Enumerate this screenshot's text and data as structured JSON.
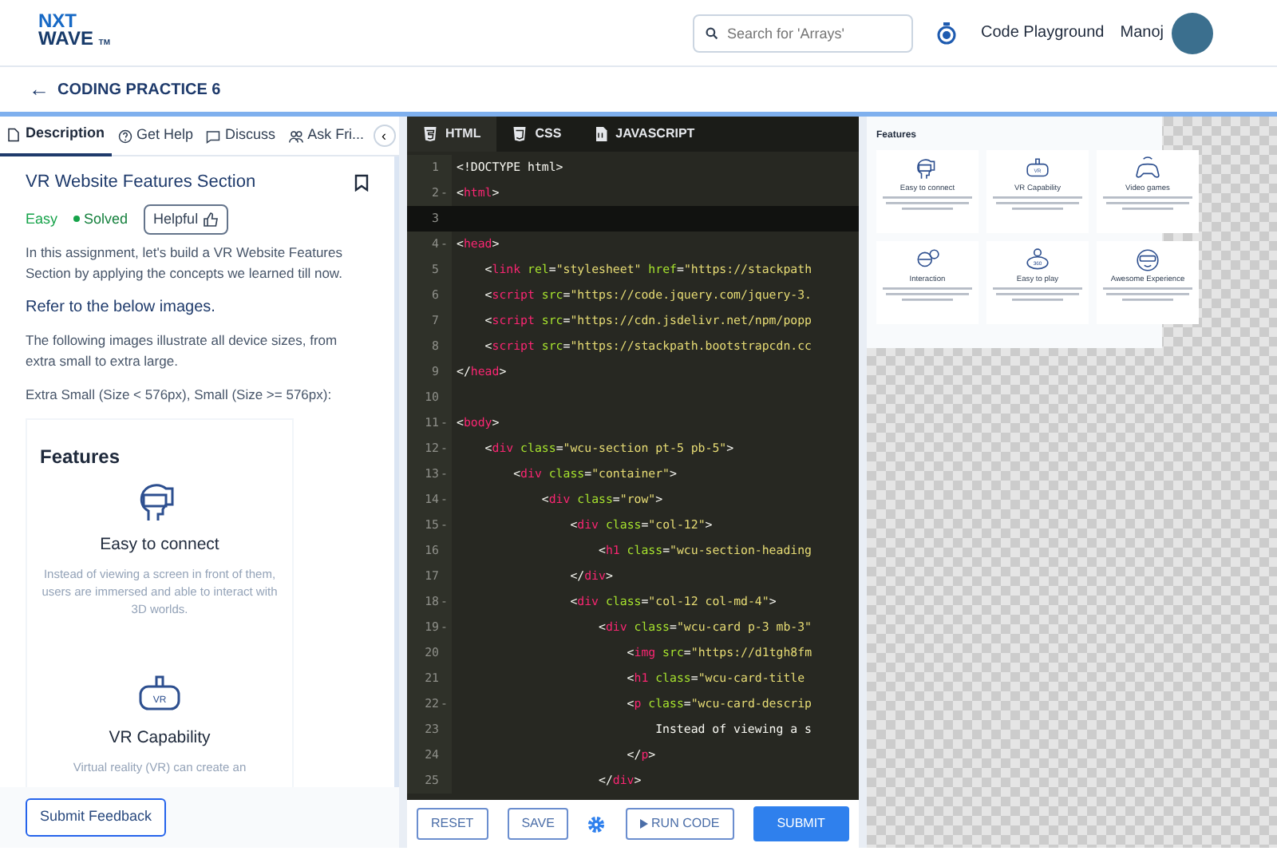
{
  "header": {
    "logo_top": "NXT",
    "logo_bottom": "WAVE",
    "logo_mark": "TM",
    "search": {
      "placeholder": "Search for 'Arrays'"
    },
    "links": [
      "Code Playground"
    ],
    "user_name": "Manoj"
  },
  "subheader": {
    "back": "←",
    "title": "CODING PRACTICE 6"
  },
  "left_tabs": [
    {
      "label": "Description",
      "selected": true
    },
    {
      "label": "Get Help",
      "selected": false
    },
    {
      "label": "Discuss",
      "selected": false
    },
    {
      "label": "Ask Fri...",
      "selected": false
    }
  ],
  "collapse": "‹",
  "problem": {
    "title": "VR Website Features Section",
    "bookmarked": false,
    "difficulty": "Easy",
    "status": "Solved",
    "helpful": "Helpful",
    "paragraphs": [
      {
        "kind": "text",
        "text": "In this assignment, let's build a VR Website Features Section by applying the concepts we learned till now."
      },
      {
        "kind": "heading",
        "text": "Refer to the below images."
      },
      {
        "kind": "text",
        "text": "The following images illustrate all device sizes, from extra small to extra large."
      },
      {
        "kind": "text",
        "text": "Extra Small (Size < 576px), Small (Size >= 576px):"
      }
    ],
    "sample": {
      "heading": "Features",
      "items": [
        {
          "title": "Easy to connect",
          "text": "Instead of viewing a screen in front of them, users are immersed and able to interact with 3D worlds."
        },
        {
          "icon_label": "VR",
          "title": "VR Capability",
          "text": "Virtual reality (VR) can create an"
        }
      ]
    }
  },
  "submit_feedback": "Submit Feedback",
  "editor": {
    "tabs": [
      {
        "label": "HTML",
        "selected": true
      },
      {
        "label": "CSS",
        "selected": false
      },
      {
        "label": "JAVASCRIPT",
        "selected": false
      }
    ],
    "lines": [
      {
        "num": "1",
        "active": false,
        "tokens": [
          {
            "kind": "text",
            "text": "<!DOCTYPE html>"
          }
        ]
      },
      {
        "num": "2",
        "fold_mark": "-",
        "active": false,
        "tokens": [
          {
            "kind": "punct",
            "text": "<"
          },
          {
            "kind": "tag",
            "text": "html"
          },
          {
            "kind": "punct",
            "text": ">"
          }
        ]
      },
      {
        "num": "3",
        "active": true
      },
      {
        "num": "4",
        "fold_mark": "-",
        "active": false,
        "tokens": [
          {
            "kind": "punct",
            "text": "<"
          },
          {
            "kind": "tag",
            "text": "head"
          },
          {
            "kind": "punct",
            "text": ">"
          }
        ]
      },
      {
        "num": "5",
        "active": false,
        "tokens": [
          {
            "kind": "punct",
            "text": "    <"
          },
          {
            "kind": "tag",
            "text": "link"
          },
          {
            "kind": "attr",
            "text": " rel"
          },
          {
            "kind": "punct",
            "text": "="
          },
          {
            "kind": "string",
            "text": "\"stylesheet\""
          },
          {
            "kind": "attr",
            "text": " href"
          },
          {
            "kind": "punct",
            "text": "="
          },
          {
            "kind": "string",
            "text": "\"https://stackpath"
          }
        ]
      },
      {
        "num": "6",
        "active": false,
        "tokens": [
          {
            "kind": "punct",
            "text": "    <"
          },
          {
            "kind": "tag",
            "text": "script"
          },
          {
            "kind": "attr",
            "text": " src"
          },
          {
            "kind": "punct",
            "text": "="
          },
          {
            "kind": "string",
            "text": "\"https://code.jquery.com/jquery-3."
          }
        ]
      },
      {
        "num": "7",
        "active": false,
        "tokens": [
          {
            "kind": "punct",
            "text": "    <"
          },
          {
            "kind": "tag",
            "text": "script"
          },
          {
            "kind": "attr",
            "text": " src"
          },
          {
            "kind": "punct",
            "text": "="
          },
          {
            "kind": "string",
            "text": "\"https://cdn.jsdelivr.net/npm/popp"
          }
        ]
      },
      {
        "num": "8",
        "active": false,
        "tokens": [
          {
            "kind": "punct",
            "text": "    <"
          },
          {
            "kind": "tag",
            "text": "script"
          },
          {
            "kind": "attr",
            "text": " src"
          },
          {
            "kind": "punct",
            "text": "="
          },
          {
            "kind": "string",
            "text": "\"https://stackpath.bootstrapcdn.cc"
          }
        ]
      },
      {
        "num": "9",
        "active": false,
        "tokens": [
          {
            "kind": "punct",
            "text": "</"
          },
          {
            "kind": "tag",
            "text": "head"
          },
          {
            "kind": "punct",
            "text": ">"
          }
        ]
      },
      {
        "num": "10",
        "active": false
      },
      {
        "num": "11",
        "fold_mark": "-",
        "active": false,
        "tokens": [
          {
            "kind": "punct",
            "text": "<"
          },
          {
            "kind": "tag",
            "text": "body"
          },
          {
            "kind": "punct",
            "text": ">"
          }
        ]
      },
      {
        "num": "12",
        "fold_mark": "-",
        "active": false,
        "tokens": [
          {
            "kind": "punct",
            "text": "    <"
          },
          {
            "kind": "tag",
            "text": "div"
          },
          {
            "kind": "attr",
            "text": " class"
          },
          {
            "kind": "punct",
            "text": "="
          },
          {
            "kind": "string",
            "text": "\"wcu-section pt-5 pb-5\""
          },
          {
            "kind": "punct",
            "text": ">"
          }
        ]
      },
      {
        "num": "13",
        "fold_mark": "-",
        "active": false,
        "tokens": [
          {
            "kind": "punct",
            "text": "        <"
          },
          {
            "kind": "tag",
            "text": "div"
          },
          {
            "kind": "attr",
            "text": " class"
          },
          {
            "kind": "punct",
            "text": "="
          },
          {
            "kind": "string",
            "text": "\"container\""
          },
          {
            "kind": "punct",
            "text": ">"
          }
        ]
      },
      {
        "num": "14",
        "fold_mark": "-",
        "active": false,
        "tokens": [
          {
            "kind": "punct",
            "text": "            <"
          },
          {
            "kind": "tag",
            "text": "div"
          },
          {
            "kind": "attr",
            "text": " class"
          },
          {
            "kind": "punct",
            "text": "="
          },
          {
            "kind": "string",
            "text": "\"row\""
          },
          {
            "kind": "punct",
            "text": ">"
          }
        ]
      },
      {
        "num": "15",
        "fold_mark": "-",
        "active": false,
        "tokens": [
          {
            "kind": "punct",
            "text": "                <"
          },
          {
            "kind": "tag",
            "text": "div"
          },
          {
            "kind": "attr",
            "text": " class"
          },
          {
            "kind": "punct",
            "text": "="
          },
          {
            "kind": "string",
            "text": "\"col-12\""
          },
          {
            "kind": "punct",
            "text": ">"
          }
        ]
      },
      {
        "num": "16",
        "active": false,
        "tokens": [
          {
            "kind": "punct",
            "text": "                    <"
          },
          {
            "kind": "tag",
            "text": "h1"
          },
          {
            "kind": "attr",
            "text": " class"
          },
          {
            "kind": "punct",
            "text": "="
          },
          {
            "kind": "string",
            "text": "\"wcu-section-heading"
          }
        ]
      },
      {
        "num": "17",
        "active": false,
        "tokens": [
          {
            "kind": "punct",
            "text": "                </"
          },
          {
            "kind": "tag",
            "text": "div"
          },
          {
            "kind": "punct",
            "text": ">"
          }
        ]
      },
      {
        "num": "18",
        "fold_mark": "-",
        "active": false,
        "tokens": [
          {
            "kind": "punct",
            "text": "                <"
          },
          {
            "kind": "tag",
            "text": "div"
          },
          {
            "kind": "attr",
            "text": " class"
          },
          {
            "kind": "punct",
            "text": "="
          },
          {
            "kind": "string",
            "text": "\"col-12 col-md-4\""
          },
          {
            "kind": "punct",
            "text": ">"
          }
        ]
      },
      {
        "num": "19",
        "fold_mark": "-",
        "active": false,
        "tokens": [
          {
            "kind": "punct",
            "text": "                    <"
          },
          {
            "kind": "tag",
            "text": "div"
          },
          {
            "kind": "attr",
            "text": " class"
          },
          {
            "kind": "punct",
            "text": "="
          },
          {
            "kind": "string",
            "text": "\"wcu-card p-3 mb-3\""
          }
        ]
      },
      {
        "num": "20",
        "active": false,
        "tokens": [
          {
            "kind": "punct",
            "text": "                        <"
          },
          {
            "kind": "tag",
            "text": "img"
          },
          {
            "kind": "attr",
            "text": " src"
          },
          {
            "kind": "punct",
            "text": "="
          },
          {
            "kind": "string",
            "text": "\"https://d1tgh8fm"
          }
        ]
      },
      {
        "num": "21",
        "active": false,
        "tokens": [
          {
            "kind": "punct",
            "text": "                        <"
          },
          {
            "kind": "tag",
            "text": "h1"
          },
          {
            "kind": "attr",
            "text": " class"
          },
          {
            "kind": "punct",
            "text": "="
          },
          {
            "kind": "string",
            "text": "\"wcu-card-title"
          }
        ]
      },
      {
        "num": "22",
        "fold_mark": "-",
        "active": false,
        "tokens": [
          {
            "kind": "punct",
            "text": "                        <"
          },
          {
            "kind": "tag",
            "text": "p"
          },
          {
            "kind": "attr",
            "text": " class"
          },
          {
            "kind": "punct",
            "text": "="
          },
          {
            "kind": "string",
            "text": "\"wcu-card-descrip"
          }
        ]
      },
      {
        "num": "23",
        "active": false,
        "tokens": [
          {
            "kind": "text",
            "text": "                            Instead of viewing a s"
          }
        ]
      },
      {
        "num": "24",
        "active": false,
        "tokens": [
          {
            "kind": "punct",
            "text": "                        </"
          },
          {
            "kind": "tag",
            "text": "p"
          },
          {
            "kind": "punct",
            "text": ">"
          }
        ]
      },
      {
        "num": "25",
        "active": false,
        "tokens": [
          {
            "kind": "punct",
            "text": "                    </"
          },
          {
            "kind": "tag",
            "text": "div"
          },
          {
            "kind": "punct",
            "text": ">"
          }
        ]
      }
    ]
  },
  "editor_buttons": [
    {
      "label": "RESET",
      "kind": "outline"
    },
    {
      "label": "SAVE",
      "kind": "outline"
    },
    {
      "kind": "settings"
    },
    {
      "label": "RUN CODE",
      "kind": "run"
    },
    {
      "label": "SUBMIT",
      "kind": "primary"
    }
  ],
  "preview": {
    "heading": "Features",
    "cards": [
      {
        "title": "Easy to connect"
      },
      {
        "icon_label": "VR",
        "title": "VR Capability"
      },
      {
        "title": "Video games"
      },
      {
        "title": "Interaction"
      },
      {
        "icon_label": "360",
        "title": "Easy to play"
      },
      {
        "title": "Awesome Experience"
      }
    ]
  }
}
